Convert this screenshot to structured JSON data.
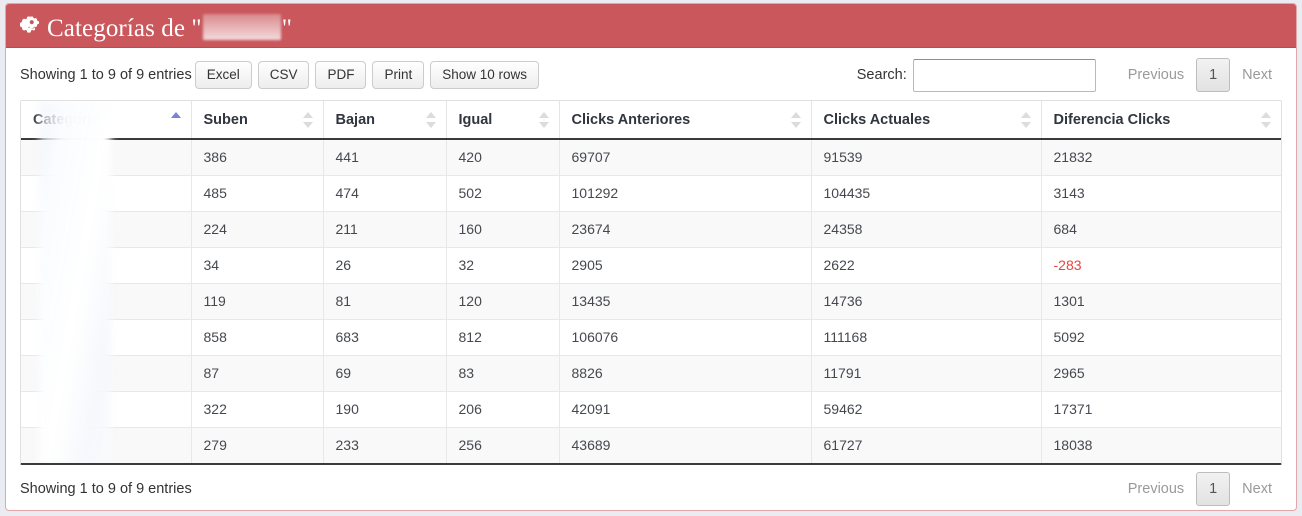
{
  "header": {
    "icon": "cogs-icon",
    "title_prefix": "Categorías de \"",
    "title_suffix": "\"",
    "redacted_label": "",
    "bg_color": "#c9575c"
  },
  "toolbar": {
    "info_top": "Showing 1 to 9 of 9 entries",
    "export_buttons": [
      {
        "name": "excel",
        "label": "Excel"
      },
      {
        "name": "csv",
        "label": "CSV"
      },
      {
        "name": "pdf",
        "label": "PDF"
      },
      {
        "name": "print",
        "label": "Print"
      },
      {
        "name": "show-rows",
        "label": "Show 10 rows"
      }
    ],
    "search_label": "Search:",
    "search_value": "",
    "search_placeholder": ""
  },
  "pagination_top": {
    "previous": "Previous",
    "current_page": "1",
    "next": "Next"
  },
  "pagination_bottom": {
    "previous": "Previous",
    "current_page": "1",
    "next": "Next"
  },
  "footer": {
    "info_bottom": "Showing 1 to 9 of 9 entries"
  },
  "table": {
    "columns": [
      {
        "key": "categoria",
        "label": "Categoria",
        "sort": "asc"
      },
      {
        "key": "suben",
        "label": "Suben",
        "sort": "none"
      },
      {
        "key": "bajan",
        "label": "Bajan",
        "sort": "none"
      },
      {
        "key": "igual",
        "label": "Igual",
        "sort": "none"
      },
      {
        "key": "clicks_anteriores",
        "label": "Clicks Anteriores",
        "sort": "none"
      },
      {
        "key": "clicks_actuales",
        "label": "Clicks Actuales",
        "sort": "none"
      },
      {
        "key": "diferencia_clicks",
        "label": "Diferencia Clicks",
        "sort": "none"
      }
    ],
    "rows": [
      {
        "categoria": "",
        "suben": "386",
        "bajan": "441",
        "igual": "420",
        "clicks_anteriores": "69707",
        "clicks_actuales": "91539",
        "diferencia_clicks": "21832",
        "diff_negative": false
      },
      {
        "categoria": "",
        "suben": "485",
        "bajan": "474",
        "igual": "502",
        "clicks_anteriores": "101292",
        "clicks_actuales": "104435",
        "diferencia_clicks": "3143",
        "diff_negative": false
      },
      {
        "categoria": "",
        "suben": "224",
        "bajan": "211",
        "igual": "160",
        "clicks_anteriores": "23674",
        "clicks_actuales": "24358",
        "diferencia_clicks": "684",
        "diff_negative": false
      },
      {
        "categoria": "",
        "suben": "34",
        "bajan": "26",
        "igual": "32",
        "clicks_anteriores": "2905",
        "clicks_actuales": "2622",
        "diferencia_clicks": "-283",
        "diff_negative": true
      },
      {
        "categoria": "",
        "suben": "119",
        "bajan": "81",
        "igual": "120",
        "clicks_anteriores": "13435",
        "clicks_actuales": "14736",
        "diferencia_clicks": "1301",
        "diff_negative": false
      },
      {
        "categoria": "",
        "suben": "858",
        "bajan": "683",
        "igual": "812",
        "clicks_anteriores": "106076",
        "clicks_actuales": "111168",
        "diferencia_clicks": "5092",
        "diff_negative": false
      },
      {
        "categoria": "",
        "suben": "87",
        "bajan": "69",
        "igual": "83",
        "clicks_anteriores": "8826",
        "clicks_actuales": "11791",
        "diferencia_clicks": "2965",
        "diff_negative": false
      },
      {
        "categoria": "",
        "suben": "322",
        "bajan": "190",
        "igual": "206",
        "clicks_anteriores": "42091",
        "clicks_actuales": "59462",
        "diferencia_clicks": "17371",
        "diff_negative": false
      },
      {
        "categoria": "",
        "suben": "279",
        "bajan": "233",
        "igual": "256",
        "clicks_anteriores": "43689",
        "clicks_actuales": "61727",
        "diferencia_clicks": "18038",
        "diff_negative": false
      }
    ]
  },
  "colors": {
    "accent": "#c9575c",
    "panel_border": "#e2a7ab",
    "page_bg": "#eaecf2",
    "sort_active": "#7b80d8",
    "negative_text": "#e8453c"
  }
}
